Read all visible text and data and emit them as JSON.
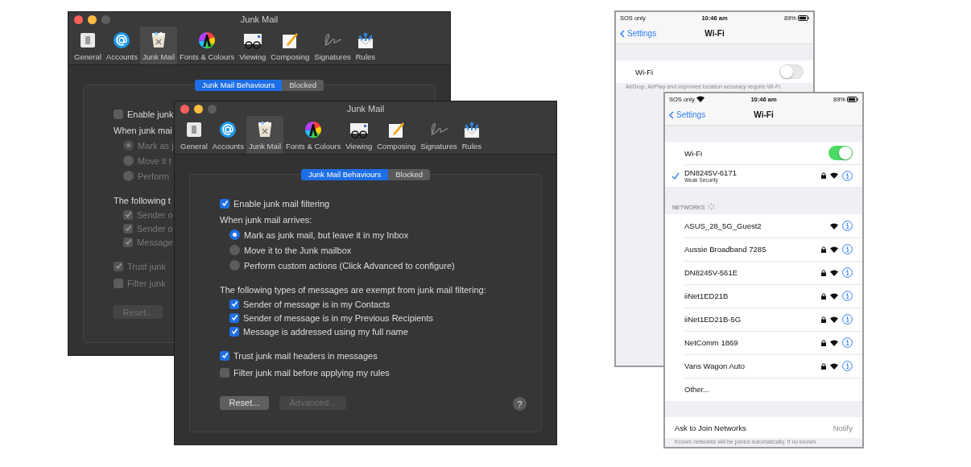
{
  "mac_windows": [
    {
      "title": "Junk Mail",
      "toolbar": [
        {
          "label": "General",
          "selected": false
        },
        {
          "label": "Accounts",
          "selected": false
        },
        {
          "label": "Junk Mail",
          "selected": true
        },
        {
          "label": "Fonts & Colours",
          "selected": false
        },
        {
          "label": "Viewing",
          "selected": false
        },
        {
          "label": "Composing",
          "selected": false
        },
        {
          "label": "Signatures",
          "selected": false
        },
        {
          "label": "Rules",
          "selected": false
        }
      ],
      "segments": [
        {
          "label": "Junk Mail Behaviours",
          "selected": true
        },
        {
          "label": "Blocked",
          "selected": false
        }
      ],
      "options": [
        {
          "kind": "checkbox",
          "label": "Enable junk",
          "checked": false,
          "disabled": false
        },
        {
          "kind": "heading",
          "label": "When junk mai",
          "disabled": false,
          "children": [
            {
              "kind": "radio",
              "label": "Mark as j",
              "selected": true,
              "disabled": true
            },
            {
              "kind": "radio",
              "label": "Move it t",
              "selected": false,
              "disabled": true
            },
            {
              "kind": "radio",
              "label": "Perform",
              "selected": false,
              "disabled": true
            }
          ]
        },
        {
          "kind": "heading",
          "label": "The following t",
          "disabled": false,
          "children": [
            {
              "kind": "checkbox",
              "label": "Sender o",
              "checked": true,
              "disabled": true
            },
            {
              "kind": "checkbox",
              "label": "Sender o",
              "checked": true,
              "disabled": true
            },
            {
              "kind": "checkbox",
              "label": "Message",
              "checked": true,
              "disabled": true
            }
          ]
        },
        {
          "kind": "checkbox",
          "label": "Trust junk",
          "checked": true,
          "disabled": true
        },
        {
          "kind": "checkbox",
          "label": "Filter junk",
          "checked": false,
          "disabled": true
        }
      ],
      "buttons": [
        {
          "label": "Reset...",
          "disabled": true
        }
      ]
    },
    {
      "title": "Junk Mail",
      "toolbar": [
        {
          "label": "General",
          "selected": false
        },
        {
          "label": "Accounts",
          "selected": false
        },
        {
          "label": "Junk Mail",
          "selected": true
        },
        {
          "label": "Fonts & Colours",
          "selected": false
        },
        {
          "label": "Viewing",
          "selected": false
        },
        {
          "label": "Composing",
          "selected": false
        },
        {
          "label": "Signatures",
          "selected": false
        },
        {
          "label": "Rules",
          "selected": false
        }
      ],
      "segments": [
        {
          "label": "Junk Mail Behaviours",
          "selected": true
        },
        {
          "label": "Blocked",
          "selected": false
        }
      ],
      "options": [
        {
          "kind": "checkbox",
          "label": "Enable junk mail filtering",
          "checked": true,
          "disabled": false
        },
        {
          "kind": "heading",
          "label": "When junk mail arrives:",
          "disabled": false,
          "children": [
            {
              "kind": "radio",
              "label": "Mark as junk mail, but leave it in my Inbox",
              "selected": true,
              "disabled": false
            },
            {
              "kind": "radio",
              "label": "Move it to the Junk mailbox",
              "selected": false,
              "disabled": false
            },
            {
              "kind": "radio",
              "label": "Perform custom actions (Click Advanced to configure)",
              "selected": false,
              "disabled": false
            }
          ]
        },
        {
          "kind": "heading",
          "label": "The following types of messages are exempt from junk mail filtering:",
          "disabled": false,
          "children": [
            {
              "kind": "checkbox",
              "label": "Sender of message is in my Contacts",
              "checked": true,
              "disabled": false
            },
            {
              "kind": "checkbox",
              "label": "Sender of message is in my Previous Recipients",
              "checked": true,
              "disabled": false
            },
            {
              "kind": "checkbox",
              "label": "Message is addressed using my full name",
              "checked": true,
              "disabled": false
            }
          ]
        },
        {
          "kind": "checkbox",
          "label": "Trust junk mail headers in messages",
          "checked": true,
          "disabled": false
        },
        {
          "kind": "checkbox",
          "label": "Filter junk mail before applying my rules",
          "checked": false,
          "disabled": false
        }
      ],
      "buttons": [
        {
          "label": "Reset...",
          "disabled": false
        },
        {
          "label": "Advanced...",
          "disabled": true
        }
      ],
      "help": "?"
    }
  ],
  "phones": [
    {
      "status": {
        "carrier": "SOS only",
        "wifi": false,
        "time": "10:46 am",
        "battery": "89%"
      },
      "nav": {
        "back": "Settings",
        "title": "Wi-Fi"
      },
      "wifi_row": {
        "label": "Wi-Fi",
        "on": false
      },
      "footer": "AirDrop, AirPlay and improved location accuracy require Wi-Fi."
    },
    {
      "status": {
        "carrier": "SOS only",
        "wifi": true,
        "time": "10:46 am",
        "battery": "89%"
      },
      "nav": {
        "back": "Settings",
        "title": "Wi-Fi"
      },
      "wifi_row": {
        "label": "Wi-Fi",
        "on": true
      },
      "connected": {
        "name": "DN8245V-6171",
        "subtitle": "Weak Security",
        "selected": true,
        "locked": true
      },
      "section_header": "NETWORKS",
      "networks": [
        {
          "name": "ASUS_28_5G_Guest2",
          "locked": false
        },
        {
          "name": "Aussie Broadband 7285",
          "locked": true
        },
        {
          "name": "DN8245V-561E",
          "locked": true
        },
        {
          "name": "iiNet1ED21B",
          "locked": true
        },
        {
          "name": "iiNet1ED21B-5G",
          "locked": true
        },
        {
          "name": "NetComm 1869",
          "locked": true
        },
        {
          "name": "Vans Wagon Auto",
          "locked": true
        }
      ],
      "other": "Other...",
      "ask_row": {
        "label": "Ask to Join Networks",
        "value": "Notify"
      },
      "footer": "Known networks will be joined automatically. If no known"
    }
  ]
}
